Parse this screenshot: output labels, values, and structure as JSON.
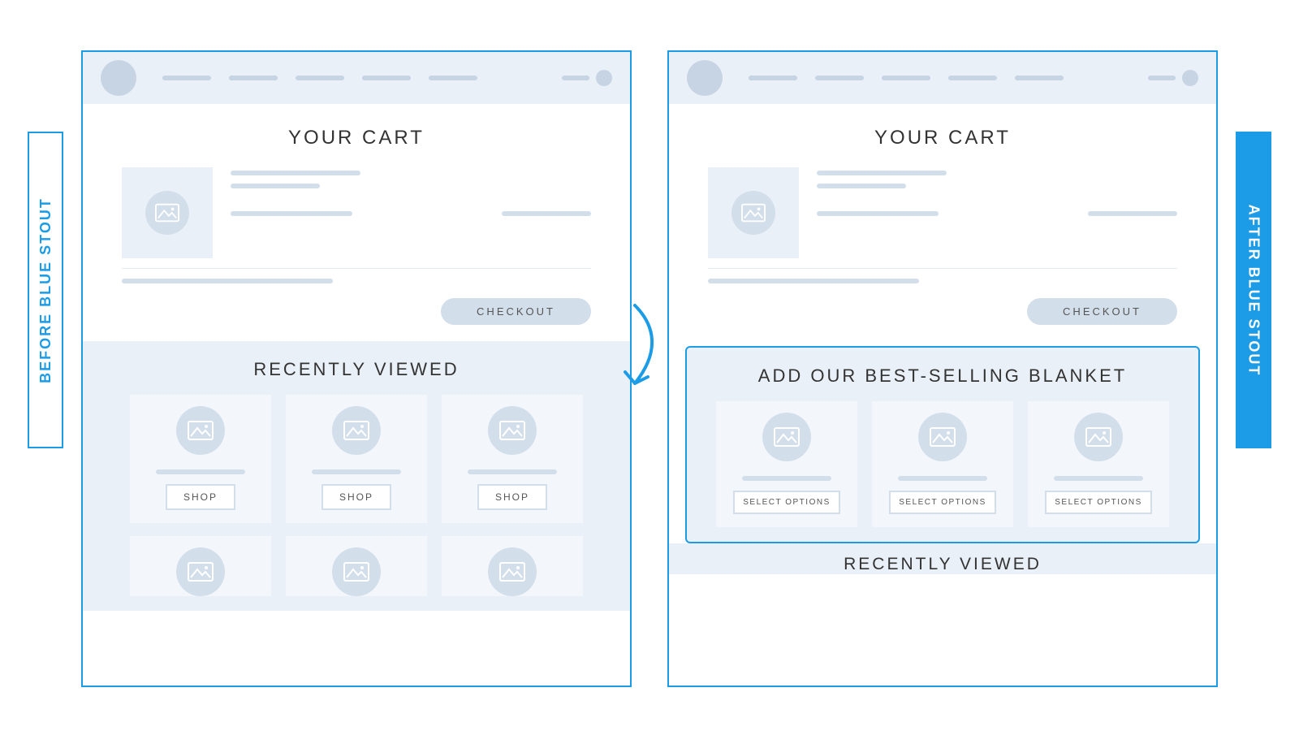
{
  "labels": {
    "before": "BEFORE  BLUE STOUT",
    "after": "AFTER  BLUE STOUT"
  },
  "icons": {
    "image": "image-icon",
    "topAvatar": "logo-avatar",
    "arrow": "highlight-arrow"
  },
  "before": {
    "cart": {
      "title": "YOUR CART",
      "checkout": "CHECKOUT"
    },
    "section1": {
      "title": "RECENTLY VIEWED",
      "cards": [
        {
          "cta": "SHOP"
        },
        {
          "cta": "SHOP"
        },
        {
          "cta": "SHOP"
        }
      ]
    }
  },
  "after": {
    "cart": {
      "title": "YOUR CART",
      "checkout": "CHECKOUT"
    },
    "upsell": {
      "title": "ADD OUR BEST-SELLING BLANKET",
      "cards": [
        {
          "cta": "SELECT OPTIONS"
        },
        {
          "cta": "SELECT OPTIONS"
        },
        {
          "cta": "SELECT OPTIONS"
        }
      ]
    },
    "recently_viewed_title": "RECENTLY VIEWED"
  }
}
